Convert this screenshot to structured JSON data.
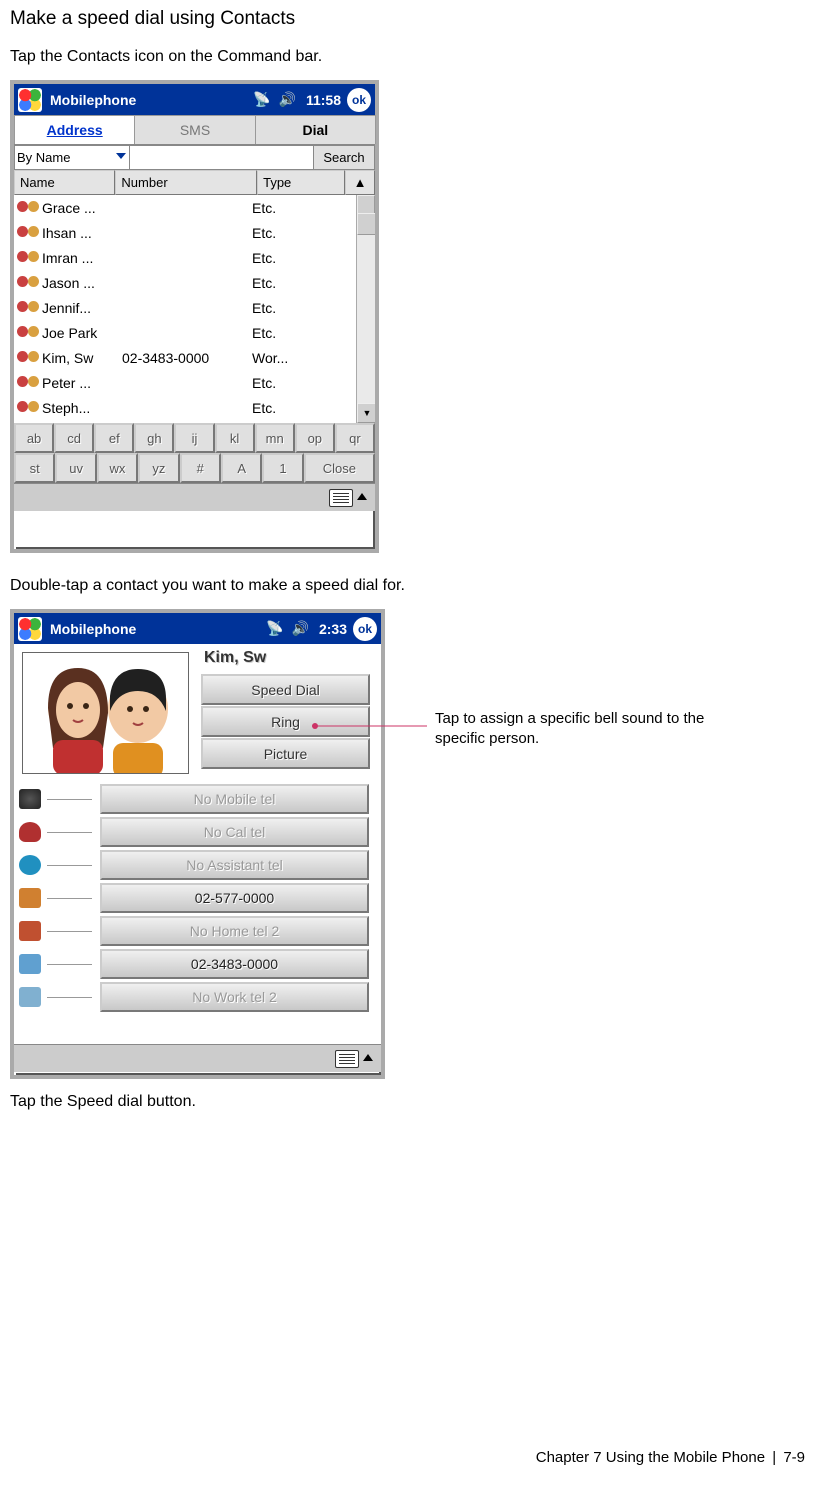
{
  "heading": "Make a speed dial using Contacts",
  "step1": "Tap the Contacts icon on the Command bar.",
  "step2": "Double-tap a contact you want to make a speed dial for.",
  "step3": "Tap the Speed dial button.",
  "annotation": "Tap to assign a specific bell sound to the specific person.",
  "footer": {
    "chapter": "Chapter 7 Using the Mobile Phone",
    "sep": "|",
    "page": "7-9"
  },
  "ss1": {
    "titlebar": {
      "title": "Mobilephone",
      "time": "11:58",
      "ok": "ok"
    },
    "tabs": {
      "address": "Address",
      "sms": "SMS",
      "dial": "Dial"
    },
    "search": {
      "mode": "By Name",
      "btn": "Search"
    },
    "thead": {
      "name": "Name",
      "number": "Number",
      "type": "Type"
    },
    "rows": [
      {
        "name": "Grace ...",
        "num": "",
        "type": "Etc."
      },
      {
        "name": "Ihsan ...",
        "num": "",
        "type": "Etc."
      },
      {
        "name": "Imran ...",
        "num": "",
        "type": "Etc."
      },
      {
        "name": "Jason ...",
        "num": "",
        "type": "Etc."
      },
      {
        "name": "Jennif...",
        "num": "",
        "type": "Etc."
      },
      {
        "name": "Joe Park",
        "num": "",
        "type": "Etc."
      },
      {
        "name": "Kim, Sw",
        "num": "02-3483-0000",
        "type": "Wor..."
      },
      {
        "name": "Peter ...",
        "num": "",
        "type": "Etc."
      },
      {
        "name": "Steph...",
        "num": "",
        "type": "Etc."
      }
    ],
    "letters1": [
      "ab",
      "cd",
      "ef",
      "gh",
      "ij",
      "kl",
      "mn",
      "op",
      "qr"
    ],
    "letters2": [
      "st",
      "uv",
      "wx",
      "yz",
      "#",
      "A",
      "1"
    ],
    "close": "Close"
  },
  "ss2": {
    "titlebar": {
      "title": "Mobilephone",
      "time": "2:33",
      "ok": "ok"
    },
    "contact": "Kim, Sw",
    "buttons": {
      "speed": "Speed Dial",
      "ring": "Ring",
      "picture": "Picture"
    },
    "tels": [
      {
        "label": "No Mobile tel",
        "enabled": false
      },
      {
        "label": "No Cal tel",
        "enabled": false
      },
      {
        "label": "No Assistant tel",
        "enabled": false
      },
      {
        "label": "02-577-0000",
        "enabled": true
      },
      {
        "label": "No Home tel 2",
        "enabled": false
      },
      {
        "label": "02-3483-0000",
        "enabled": true
      },
      {
        "label": "No Work tel 2",
        "enabled": false
      }
    ]
  }
}
